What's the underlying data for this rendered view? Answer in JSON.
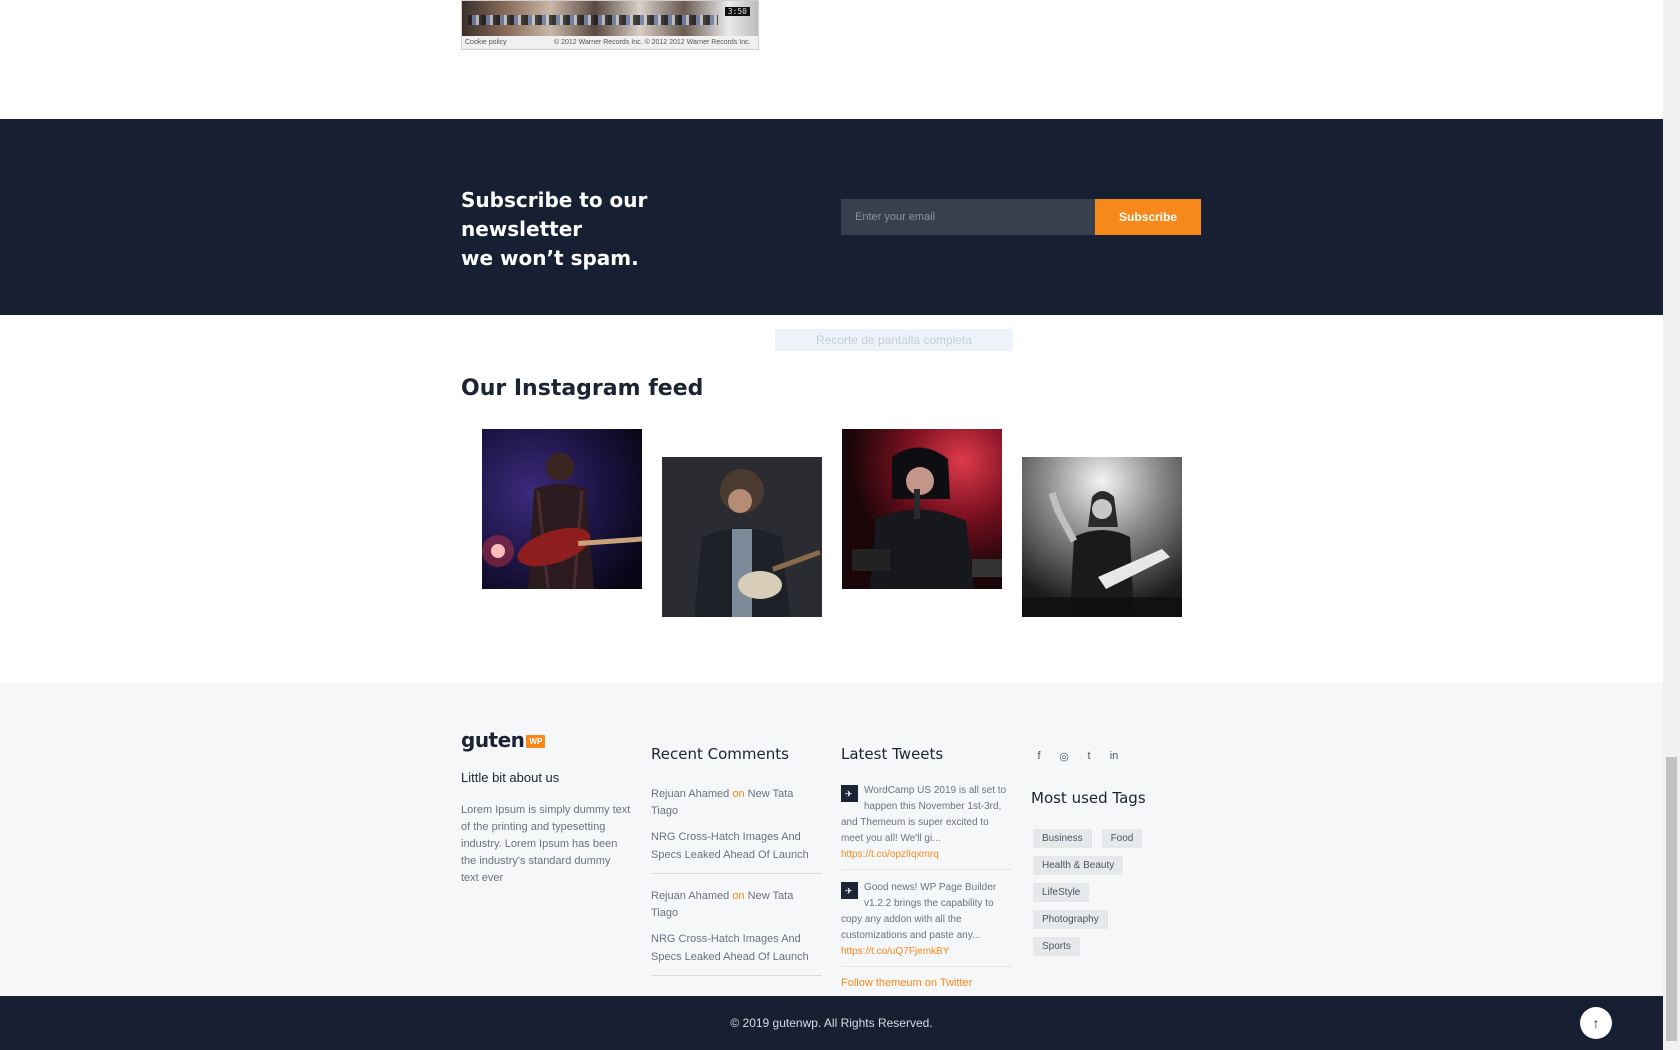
{
  "video": {
    "time": "3:50",
    "cookie_label": "Cookie policy",
    "copyright": "© 2012 Warner Records Inc. © 2012 2012 Warner Records Inc."
  },
  "newsletter": {
    "title_line1": "Subscribe to our newsletter",
    "title_line2": "we won’t spam.",
    "email_placeholder": "Enter your email",
    "button_label": "Subscribe",
    "background": "#162032",
    "accent": "#f7891b"
  },
  "overlay_label": "Recorte de pantalla completa",
  "instagram": {
    "title": "Our Instagram feed",
    "images": [
      "guitarist-red-guitar-photo",
      "curly-hair-guitarist-photo",
      "singer-red-light-photo",
      "metal-guitarist-spotlight-photo"
    ]
  },
  "footer": {
    "logo_text": "guten",
    "logo_badge": "WP",
    "about_heading": "Little bit about us",
    "about_text": "Lorem Ipsum is simply dummy text of the printing and typesetting industry. Lorem Ipsum has been the industry's standard dummy text ever",
    "recent_comments": {
      "heading": "Recent Comments",
      "items": [
        {
          "author": "Rejuan Ahamed",
          "on": "on",
          "post": "New Tata Tiago",
          "title": "NRG Cross-Hatch Images And Specs Leaked Ahead Of Launch"
        },
        {
          "author": "Rejuan Ahamed",
          "on": "on",
          "post": "New Tata Tiago",
          "title": "NRG Cross-Hatch Images And Specs Leaked Ahead Of Launch"
        }
      ]
    },
    "latest_tweets": {
      "heading": "Latest Tweets",
      "items": [
        {
          "text": "WordCamp US 2019 is all set to happen this November 1st-3rd, and Themeum is super excited to meet you all! We'll gi...",
          "link": "https://t.co/opzlIqxmrq"
        },
        {
          "text": "Good news! WP Page Builder v1.2.2 brings the capability to copy any addon with all the customizations and paste any...",
          "link": "https://t.co/uQ7FjemkBY"
        }
      ],
      "follow": "Follow themeum on Twitter"
    },
    "socials": [
      "f",
      "◎",
      "t",
      "in"
    ],
    "tags": {
      "heading": "Most used Tags",
      "items": [
        "Business",
        "Food",
        "Health & Beauty",
        "LifeStyle",
        "Photography",
        "Sports"
      ]
    },
    "copyright": "© 2019 gutenwp. All Rights Reserved.",
    "to_top": "↑"
  }
}
